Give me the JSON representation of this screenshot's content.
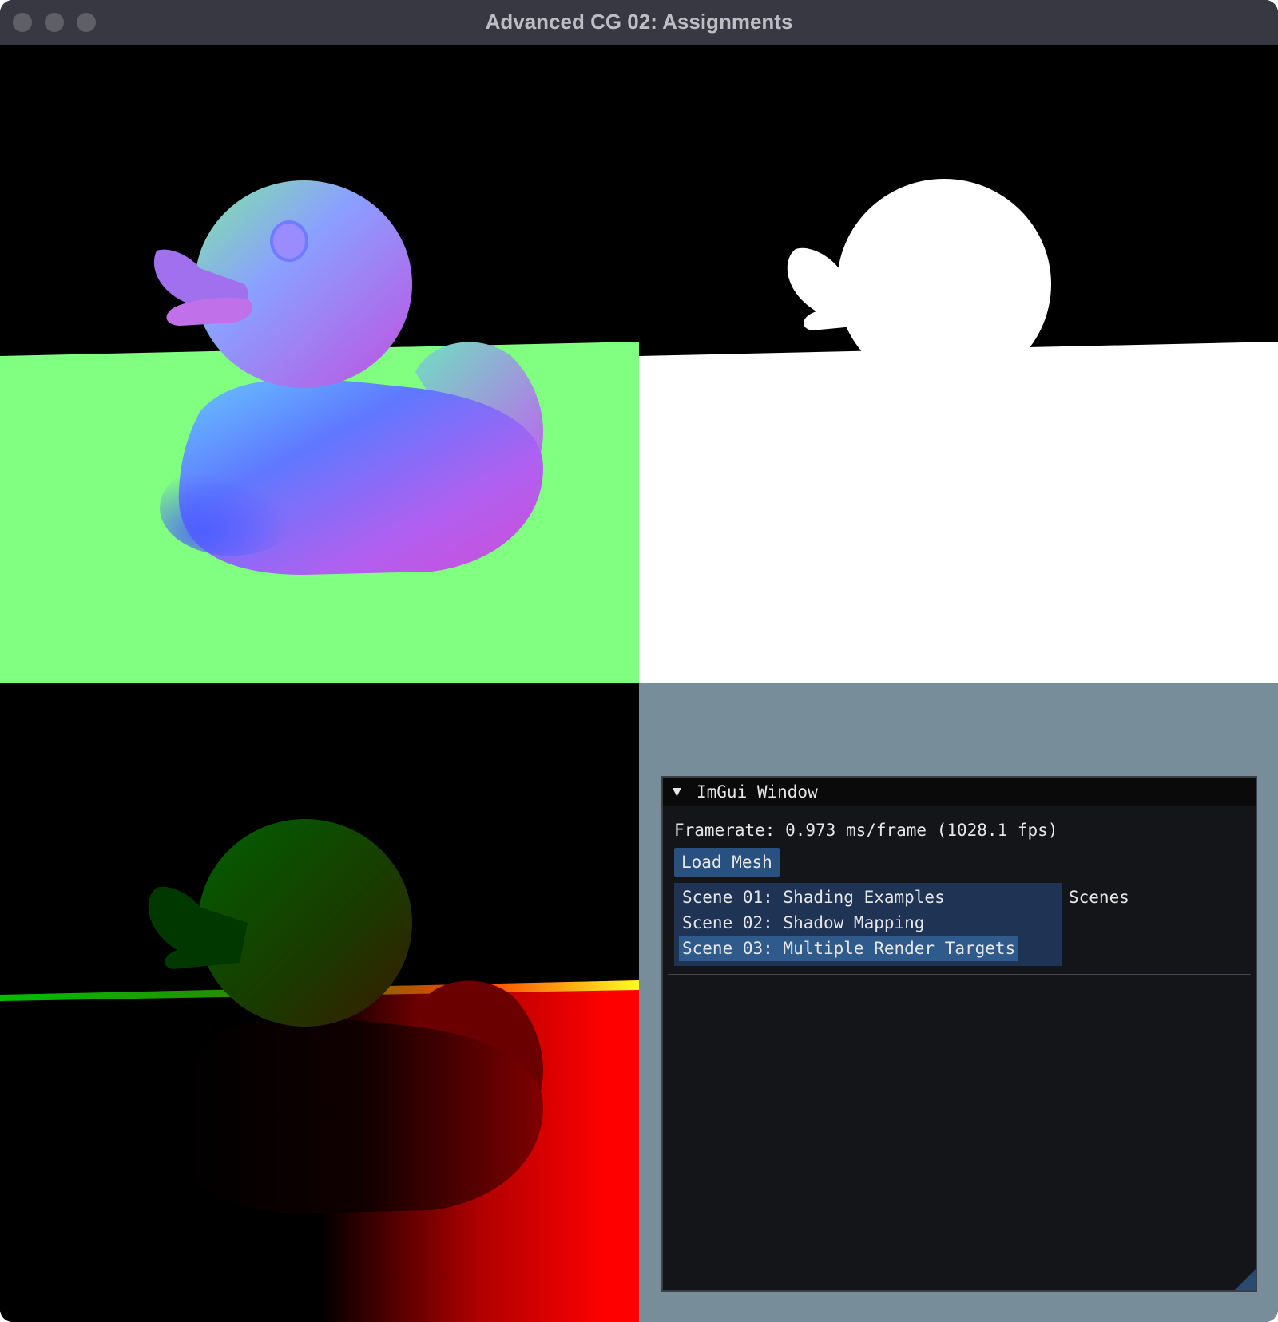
{
  "window": {
    "title": "Advanced CG 02: Assignments"
  },
  "viewports": {
    "normals": "normal-buffer-view",
    "mask": "mask-buffer-view",
    "depth": "position-buffer-view"
  },
  "colors": {
    "titlebar": "#383842",
    "gui_background": "#778d9a",
    "imgui_panel": "#141518",
    "button": "#285080",
    "listbox": "#1f3354",
    "selected_item": "#2f5b8c",
    "floor_normal_green": "#80ff80"
  },
  "imgui": {
    "title": "ImGui Window",
    "collapse_icon": "triangle-down-icon",
    "framerate": "Framerate: 0.973 ms/frame (1028.1 fps)",
    "load_mesh_label": "Load Mesh",
    "scenes_label": "Scenes",
    "scenes": [
      "Scene 01: Shading Examples",
      "Scene 02: Shadow Mapping",
      "Scene 03: Multiple Render Targets"
    ],
    "selected_scene": "Scene 03: Multiple Render Targets"
  }
}
